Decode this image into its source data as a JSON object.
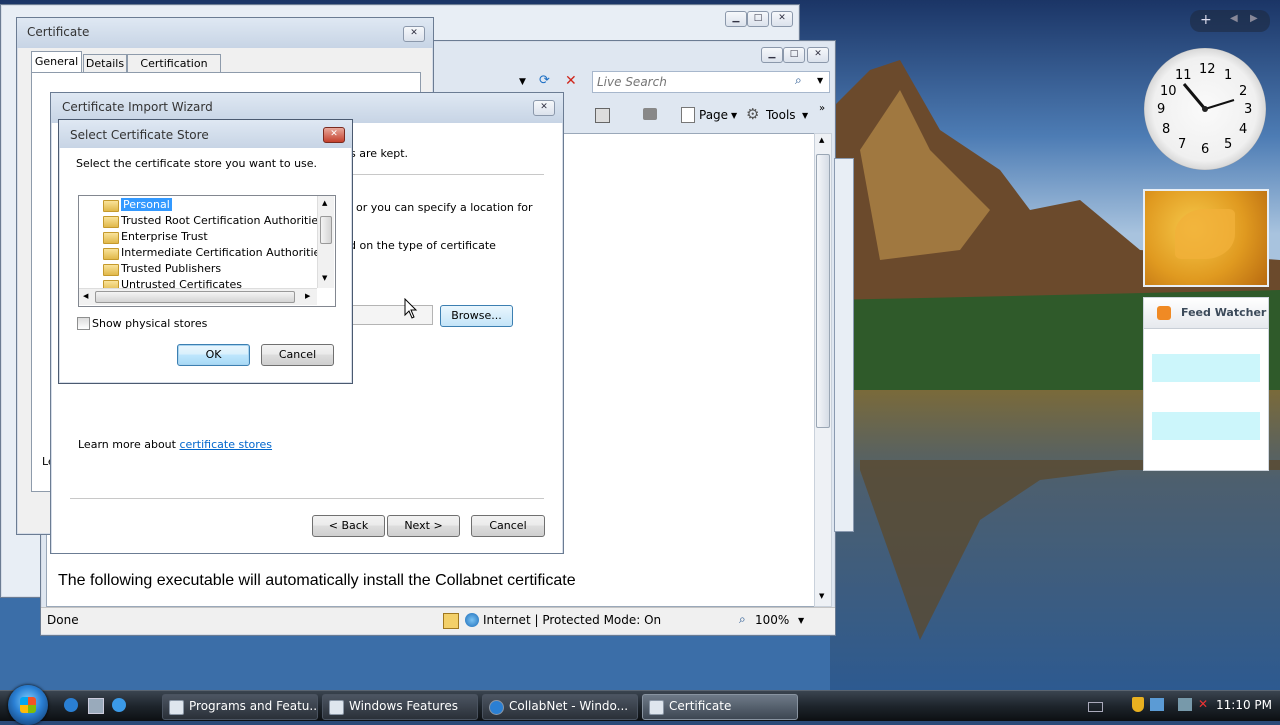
{
  "taskbar": {
    "tasks": [
      {
        "label": "Programs and Featu..."
      },
      {
        "label": "Windows Features"
      },
      {
        "label": "CollabNet - Windo..."
      },
      {
        "label": "Certificate"
      }
    ],
    "time": "11:10 PM"
  },
  "gadgets": {
    "feed_title": "Feed Watcher",
    "clock_numbers": [
      "12",
      "1",
      "2",
      "3",
      "4",
      "5",
      "6",
      "7",
      "8",
      "9",
      "10",
      "11"
    ]
  },
  "ie": {
    "search_placeholder": "Live Search",
    "toolbar": {
      "page": "Page",
      "tools": "Tools"
    },
    "content_text": "The following executable will automatically install the Collabnet certificate",
    "status": "Done",
    "zone": "Internet | Protected Mode: On",
    "zoom": "100%"
  },
  "certificate": {
    "title": "Certificate",
    "tabs": [
      "General",
      "Details",
      "Certification Path"
    ],
    "partial_label": "Le"
  },
  "wizard": {
    "title": "Certificate Import Wizard",
    "text1": "s are kept.",
    "text2": "or you can specify a location for",
    "text3": "d on the type of certificate",
    "browse": "Browse...",
    "learn_prefix": "Learn more about ",
    "learn_link": "certificate stores",
    "back": "< Back",
    "next": "Next >",
    "cancel": "Cancel"
  },
  "store_dialog": {
    "title": "Select Certificate Store",
    "prompt": "Select the certificate store you want to use.",
    "stores": [
      {
        "label": "Personal"
      },
      {
        "label": "Trusted Root Certification Authorities"
      },
      {
        "label": "Enterprise Trust"
      },
      {
        "label": "Intermediate Certification Authorities"
      },
      {
        "label": "Trusted Publishers"
      },
      {
        "label": "Untrusted Certificates"
      }
    ],
    "show_physical": "Show physical stores",
    "ok": "OK",
    "cancel": "Cancel"
  }
}
